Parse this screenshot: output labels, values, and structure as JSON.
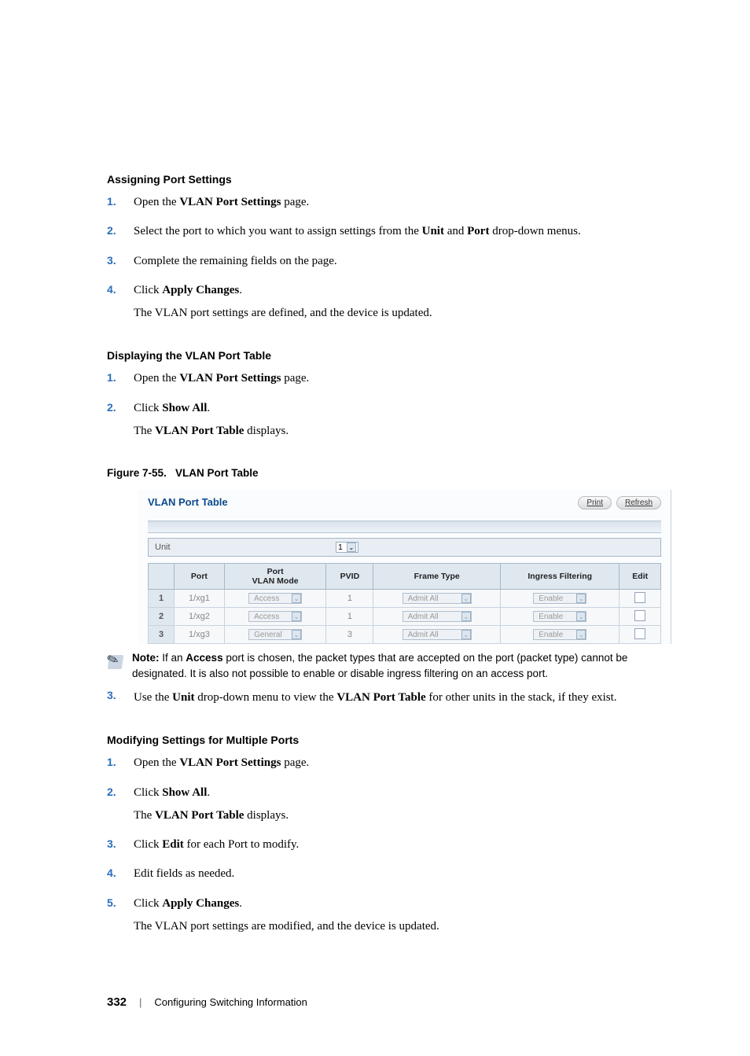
{
  "sections": {
    "assigning": {
      "title": "Assigning Port Settings",
      "steps": [
        {
          "num": "1.",
          "parts": [
            "Open the ",
            "VLAN Port Settings",
            " page."
          ]
        },
        {
          "num": "2.",
          "parts": [
            "Select the port to which you want to assign settings from the ",
            "Unit",
            " and ",
            "Port",
            " drop-down menus."
          ]
        },
        {
          "num": "3.",
          "parts": [
            "Complete the remaining fields on the page."
          ]
        },
        {
          "num": "4.",
          "parts": [
            "Click ",
            "Apply Changes",
            "."
          ],
          "followup": "The VLAN port settings are defined, and the device is updated."
        }
      ]
    },
    "displaying": {
      "title": "Displaying the VLAN Port Table",
      "steps": [
        {
          "num": "1.",
          "parts": [
            "Open the ",
            "VLAN Port Settings",
            " page."
          ]
        },
        {
          "num": "2.",
          "parts": [
            "Click ",
            "Show All",
            "."
          ],
          "followup_parts": [
            "The ",
            "VLAN Port Table",
            " displays."
          ]
        }
      ]
    },
    "modifying": {
      "title": "Modifying Settings for Multiple Ports",
      "steps": [
        {
          "num": "1.",
          "parts": [
            "Open the ",
            "VLAN Port Settings",
            " page."
          ]
        },
        {
          "num": "2.",
          "parts": [
            "Click ",
            "Show All",
            "."
          ],
          "followup_parts": [
            "The ",
            "VLAN Port Table",
            " displays."
          ]
        },
        {
          "num": "3.",
          "parts": [
            "Click ",
            "Edit",
            " for each Port to modify."
          ]
        },
        {
          "num": "4.",
          "parts": [
            "Edit fields as needed."
          ]
        },
        {
          "num": "5.",
          "parts": [
            "Click ",
            "Apply Changes",
            "."
          ],
          "followup": "The VLAN port settings are modified, and the device is updated."
        }
      ]
    }
  },
  "figure": {
    "caption_prefix": "Figure 7-55.",
    "caption_title": "VLAN Port Table"
  },
  "shot": {
    "title": "VLAN Port Table",
    "print": "Print",
    "refresh": "Refresh",
    "unit_label": "Unit",
    "unit_value": "1",
    "columns": [
      "",
      "Port",
      "Port\nVLAN Mode",
      "PVID",
      "Frame Type",
      "Ingress Filtering",
      "Edit"
    ],
    "rows": [
      {
        "idx": "1",
        "port": "1/xg1",
        "mode": "Access",
        "pvid": "1",
        "frame": "Admit All",
        "ingress": "Enable"
      },
      {
        "idx": "2",
        "port": "1/xg2",
        "mode": "Access",
        "pvid": "1",
        "frame": "Admit All",
        "ingress": "Enable"
      },
      {
        "idx": "3",
        "port": "1/xg3",
        "mode": "General",
        "pvid": "3",
        "frame": "Admit All",
        "ingress": "Enable"
      }
    ]
  },
  "note": {
    "label": "Note:",
    "body_parts": [
      " If an ",
      "Access",
      " port is chosen, the packet types that are accepted on the port (packet type) cannot be designated. It is also not possible to enable or disable ingress filtering on an access port."
    ]
  },
  "after_note_step": {
    "num": "3.",
    "parts": [
      "Use the ",
      "Unit",
      " drop-down menu to view the ",
      "VLAN Port Table",
      " for other units in the stack, if they exist."
    ]
  },
  "footer": {
    "page": "332",
    "section": "Configuring Switching Information"
  }
}
